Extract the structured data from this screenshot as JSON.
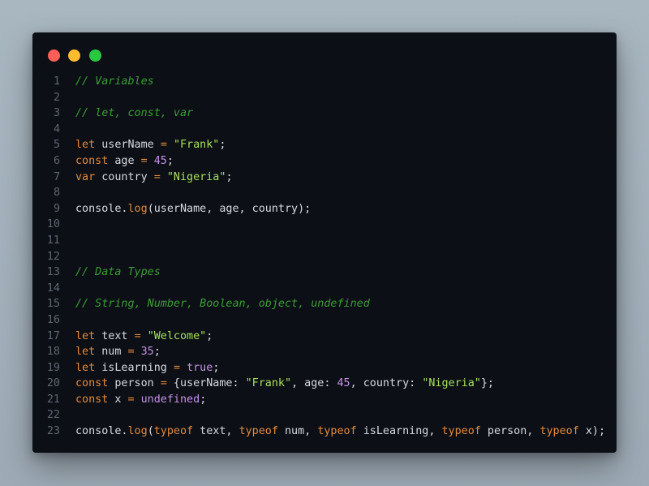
{
  "window": {
    "controls": {
      "close_color": "#ff5f57",
      "minimize_color": "#febc2e",
      "maximize_color": "#28c840"
    }
  },
  "editor": {
    "lines": [
      {
        "number": "1",
        "tokens": [
          {
            "type": "comment",
            "text": "// Variables"
          }
        ]
      },
      {
        "number": "2",
        "tokens": []
      },
      {
        "number": "3",
        "tokens": [
          {
            "type": "comment",
            "text": "// let, const, var"
          }
        ]
      },
      {
        "number": "4",
        "tokens": []
      },
      {
        "number": "5",
        "tokens": [
          {
            "type": "keyword",
            "text": "let"
          },
          {
            "type": "plain",
            "text": " userName "
          },
          {
            "type": "op",
            "text": "="
          },
          {
            "type": "plain",
            "text": " "
          },
          {
            "type": "string",
            "text": "\"Frank\""
          },
          {
            "type": "plain",
            "text": ";"
          }
        ]
      },
      {
        "number": "6",
        "tokens": [
          {
            "type": "keyword",
            "text": "const"
          },
          {
            "type": "plain",
            "text": " age "
          },
          {
            "type": "op",
            "text": "="
          },
          {
            "type": "plain",
            "text": " "
          },
          {
            "type": "number",
            "text": "45"
          },
          {
            "type": "plain",
            "text": ";"
          }
        ]
      },
      {
        "number": "7",
        "tokens": [
          {
            "type": "keyword",
            "text": "var"
          },
          {
            "type": "plain",
            "text": " country "
          },
          {
            "type": "op",
            "text": "="
          },
          {
            "type": "plain",
            "text": " "
          },
          {
            "type": "string",
            "text": "\"Nigeria\""
          },
          {
            "type": "plain",
            "text": ";"
          }
        ]
      },
      {
        "number": "8",
        "tokens": []
      },
      {
        "number": "9",
        "tokens": [
          {
            "type": "plain",
            "text": "console."
          },
          {
            "type": "method",
            "text": "log"
          },
          {
            "type": "plain",
            "text": "(userName, age, country);"
          }
        ]
      },
      {
        "number": "10",
        "tokens": []
      },
      {
        "number": "11",
        "tokens": []
      },
      {
        "number": "12",
        "tokens": []
      },
      {
        "number": "13",
        "tokens": [
          {
            "type": "comment",
            "text": "// Data Types"
          }
        ]
      },
      {
        "number": "14",
        "tokens": []
      },
      {
        "number": "15",
        "tokens": [
          {
            "type": "comment",
            "text": "// String, Number, Boolean, object, undefined"
          }
        ]
      },
      {
        "number": "16",
        "tokens": []
      },
      {
        "number": "17",
        "tokens": [
          {
            "type": "keyword",
            "text": "let"
          },
          {
            "type": "plain",
            "text": " text "
          },
          {
            "type": "op",
            "text": "="
          },
          {
            "type": "plain",
            "text": " "
          },
          {
            "type": "string",
            "text": "\"Welcome\""
          },
          {
            "type": "plain",
            "text": ";"
          }
        ]
      },
      {
        "number": "18",
        "tokens": [
          {
            "type": "keyword",
            "text": "let"
          },
          {
            "type": "plain",
            "text": " num "
          },
          {
            "type": "op",
            "text": "="
          },
          {
            "type": "plain",
            "text": " "
          },
          {
            "type": "number",
            "text": "35"
          },
          {
            "type": "plain",
            "text": ";"
          }
        ]
      },
      {
        "number": "19",
        "tokens": [
          {
            "type": "keyword",
            "text": "let"
          },
          {
            "type": "plain",
            "text": " isLearning "
          },
          {
            "type": "op",
            "text": "="
          },
          {
            "type": "plain",
            "text": " "
          },
          {
            "type": "const",
            "text": "true"
          },
          {
            "type": "plain",
            "text": ";"
          }
        ]
      },
      {
        "number": "20",
        "tokens": [
          {
            "type": "keyword",
            "text": "const"
          },
          {
            "type": "plain",
            "text": " person "
          },
          {
            "type": "op",
            "text": "="
          },
          {
            "type": "plain",
            "text": " {userName: "
          },
          {
            "type": "string",
            "text": "\"Frank\""
          },
          {
            "type": "plain",
            "text": ", age: "
          },
          {
            "type": "number",
            "text": "45"
          },
          {
            "type": "plain",
            "text": ", country: "
          },
          {
            "type": "string",
            "text": "\"Nigeria\""
          },
          {
            "type": "plain",
            "text": "};"
          }
        ]
      },
      {
        "number": "21",
        "tokens": [
          {
            "type": "keyword",
            "text": "const"
          },
          {
            "type": "plain",
            "text": " x "
          },
          {
            "type": "op",
            "text": "="
          },
          {
            "type": "plain",
            "text": " "
          },
          {
            "type": "const",
            "text": "undefined"
          },
          {
            "type": "plain",
            "text": ";"
          }
        ]
      },
      {
        "number": "22",
        "tokens": []
      },
      {
        "number": "23",
        "tokens": [
          {
            "type": "plain",
            "text": "console."
          },
          {
            "type": "method",
            "text": "log"
          },
          {
            "type": "plain",
            "text": "("
          },
          {
            "type": "keyword",
            "text": "typeof"
          },
          {
            "type": "plain",
            "text": " text, "
          },
          {
            "type": "keyword",
            "text": "typeof"
          },
          {
            "type": "plain",
            "text": " num, "
          },
          {
            "type": "keyword",
            "text": "typeof"
          },
          {
            "type": "plain",
            "text": " isLearning, "
          },
          {
            "type": "keyword",
            "text": "typeof"
          },
          {
            "type": "plain",
            "text": " person, "
          },
          {
            "type": "keyword",
            "text": "typeof"
          },
          {
            "type": "plain",
            "text": " x);"
          }
        ]
      }
    ]
  }
}
